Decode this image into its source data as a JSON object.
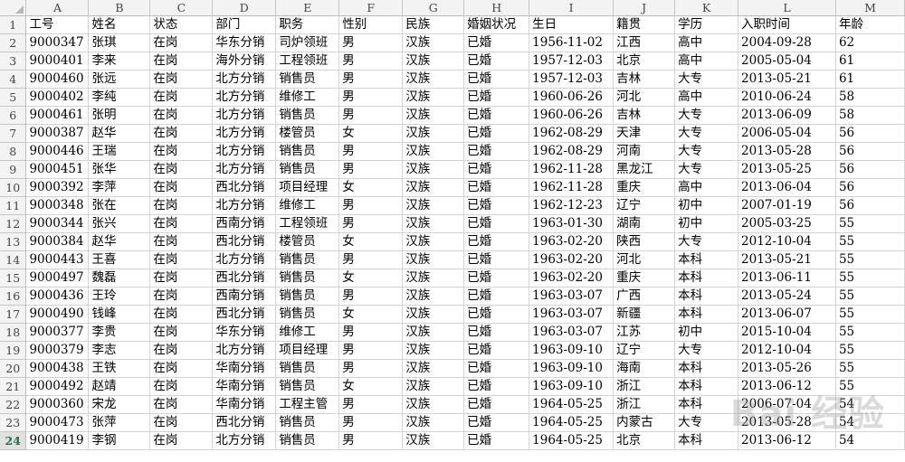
{
  "sheet": {
    "column_letters": [
      "A",
      "B",
      "C",
      "D",
      "E",
      "F",
      "G",
      "H",
      "I",
      "J",
      "K",
      "L",
      "M"
    ],
    "header_row_number": "1",
    "headers": [
      "工号",
      "姓名",
      "状态",
      "部门",
      "职务",
      "性别",
      "民族",
      "婚姻状况",
      "生日",
      "籍贯",
      "学历",
      "入职时间",
      "年龄"
    ],
    "rows": [
      {
        "n": "2",
        "cells": [
          "9000347",
          "张琪",
          "在岗",
          "华东分销",
          "司炉领班",
          "男",
          "汉族",
          "已婚",
          "1956-11-02",
          "江西",
          "高中",
          "2004-09-28",
          "62"
        ]
      },
      {
        "n": "3",
        "cells": [
          "9000401",
          "李来",
          "在岗",
          "海外分销",
          "工程领班",
          "男",
          "汉族",
          "已婚",
          "1957-12-03",
          "北京",
          "高中",
          "2005-05-04",
          "61"
        ]
      },
      {
        "n": "4",
        "cells": [
          "9000460",
          "张远",
          "在岗",
          "北方分销",
          "销售员",
          "男",
          "汉族",
          "已婚",
          "1957-12-03",
          "吉林",
          "大专",
          "2013-05-21",
          "61"
        ]
      },
      {
        "n": "5",
        "cells": [
          "9000402",
          "李纯",
          "在岗",
          "北方分销",
          "维修工",
          "男",
          "汉族",
          "已婚",
          "1960-06-26",
          "河北",
          "高中",
          "2010-06-24",
          "58"
        ]
      },
      {
        "n": "6",
        "cells": [
          "9000461",
          "张明",
          "在岗",
          "北方分销",
          "销售员",
          "男",
          "汉族",
          "已婚",
          "1960-06-26",
          "吉林",
          "大专",
          "2013-06-09",
          "58"
        ]
      },
      {
        "n": "7",
        "cells": [
          "9000387",
          "赵华",
          "在岗",
          "北方分销",
          "楼管员",
          "女",
          "汉族",
          "已婚",
          "1962-08-29",
          "天津",
          "大专",
          "2006-05-04",
          "56"
        ]
      },
      {
        "n": "8",
        "cells": [
          "9000446",
          "王瑞",
          "在岗",
          "北方分销",
          "销售员",
          "男",
          "汉族",
          "已婚",
          "1962-08-29",
          "河南",
          "大专",
          "2013-05-28",
          "56"
        ]
      },
      {
        "n": "9",
        "cells": [
          "9000451",
          "张华",
          "在岗",
          "北方分销",
          "销售员",
          "男",
          "汉族",
          "已婚",
          "1962-11-28",
          "黑龙江",
          "大专",
          "2013-05-25",
          "56"
        ]
      },
      {
        "n": "10",
        "cells": [
          "9000392",
          "李萍",
          "在岗",
          "西北分销",
          "项目经理",
          "女",
          "汉族",
          "已婚",
          "1962-11-28",
          "重庆",
          "高中",
          "2013-06-04",
          "56"
        ]
      },
      {
        "n": "11",
        "cells": [
          "9000348",
          "张在",
          "在岗",
          "北方分销",
          "维修工",
          "男",
          "汉族",
          "已婚",
          "1962-12-23",
          "辽宁",
          "初中",
          "2007-01-19",
          "56"
        ]
      },
      {
        "n": "12",
        "cells": [
          "9000344",
          "张兴",
          "在岗",
          "西南分销",
          "工程领班",
          "男",
          "汉族",
          "已婚",
          "1963-01-30",
          "湖南",
          "初中",
          "2005-03-25",
          "55"
        ]
      },
      {
        "n": "13",
        "cells": [
          "9000384",
          "赵华",
          "在岗",
          "西北分销",
          "楼管员",
          "女",
          "汉族",
          "已婚",
          "1963-02-20",
          "陕西",
          "大专",
          "2012-10-04",
          "55"
        ]
      },
      {
        "n": "14",
        "cells": [
          "9000443",
          "王喜",
          "在岗",
          "北方分销",
          "销售员",
          "男",
          "汉族",
          "已婚",
          "1963-02-20",
          "河北",
          "本科",
          "2013-05-21",
          "55"
        ]
      },
      {
        "n": "15",
        "cells": [
          "9000497",
          "魏磊",
          "在岗",
          "西北分销",
          "销售员",
          "女",
          "汉族",
          "已婚",
          "1963-02-20",
          "重庆",
          "本科",
          "2013-06-11",
          "55"
        ]
      },
      {
        "n": "16",
        "cells": [
          "9000436",
          "王玲",
          "在岗",
          "西南分销",
          "销售员",
          "男",
          "汉族",
          "已婚",
          "1963-03-07",
          "广西",
          "本科",
          "2013-05-24",
          "55"
        ]
      },
      {
        "n": "17",
        "cells": [
          "9000490",
          "钱峰",
          "在岗",
          "西北分销",
          "销售员",
          "女",
          "汉族",
          "已婚",
          "1963-03-07",
          "新疆",
          "本科",
          "2013-06-07",
          "55"
        ]
      },
      {
        "n": "18",
        "cells": [
          "9000377",
          "李贵",
          "在岗",
          "华东分销",
          "维修工",
          "男",
          "汉族",
          "已婚",
          "1963-03-07",
          "江苏",
          "初中",
          "2015-10-04",
          "55"
        ]
      },
      {
        "n": "19",
        "cells": [
          "9000379",
          "李志",
          "在岗",
          "北方分销",
          "项目经理",
          "男",
          "汉族",
          "已婚",
          "1963-09-10",
          "辽宁",
          "大专",
          "2012-10-04",
          "55"
        ]
      },
      {
        "n": "20",
        "cells": [
          "9000438",
          "王铁",
          "在岗",
          "华南分销",
          "销售员",
          "男",
          "汉族",
          "已婚",
          "1963-09-10",
          "海南",
          "本科",
          "2013-05-26",
          "55"
        ]
      },
      {
        "n": "21",
        "cells": [
          "9000492",
          "赵靖",
          "在岗",
          "华南分销",
          "销售员",
          "女",
          "汉族",
          "已婚",
          "1963-09-10",
          "浙江",
          "本科",
          "2013-06-12",
          "55"
        ]
      },
      {
        "n": "22",
        "cells": [
          "9000360",
          "宋龙",
          "在岗",
          "华南分销",
          "工程主管",
          "男",
          "汉族",
          "已婚",
          "1964-05-25",
          "浙江",
          "本科",
          "2006-07-04",
          "54"
        ]
      },
      {
        "n": "23",
        "cells": [
          "9000473",
          "张萍",
          "在岗",
          "西北分销",
          "销售员",
          "男",
          "汉族",
          "已婚",
          "1964-05-25",
          "内蒙古",
          "大专",
          "2013-05-28",
          "54"
        ]
      },
      {
        "n": "24",
        "cells": [
          "9000419",
          "李钢",
          "在岗",
          "北方分销",
          "销售员",
          "男",
          "汉族",
          "已婚",
          "1964-05-25",
          "北京",
          "本科",
          "2013-06-12",
          "54"
        ]
      }
    ],
    "numeric_columns": [
      0,
      12
    ]
  },
  "watermark_text": "Bai 经验"
}
